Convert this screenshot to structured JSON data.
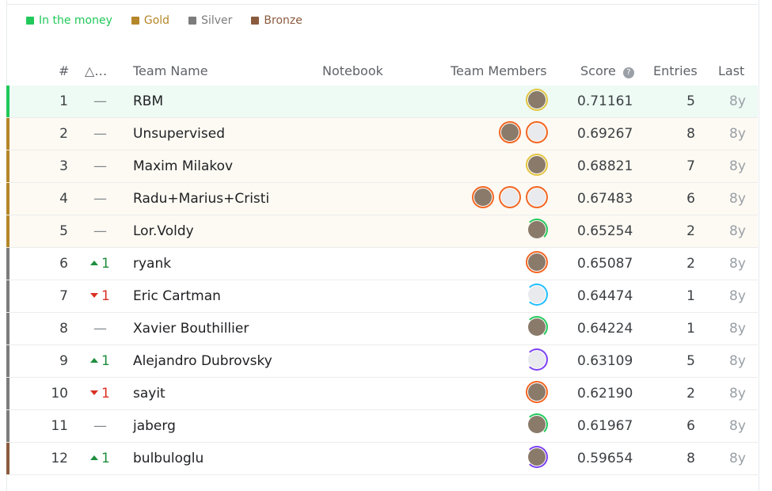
{
  "legend": [
    {
      "label": "In the money",
      "color": "#20c95a"
    },
    {
      "label": "Gold",
      "color": "#b5872a"
    },
    {
      "label": "Silver",
      "color": "#7c7c7c"
    },
    {
      "label": "Bronze",
      "color": "#8b5b3e"
    }
  ],
  "header": {
    "rank": "#",
    "delta": "△…",
    "team": "Team Name",
    "notebook": "Notebook",
    "members": "Team Members",
    "score": "Score",
    "entries": "Entries",
    "last": "Last"
  },
  "rows": [
    {
      "rank": "1",
      "delta": "—",
      "dir": "none",
      "team": "RBM",
      "score": "0.71161",
      "entries": "5",
      "last": "8y",
      "tier": "money",
      "members": [
        {
          "ring": "gold",
          "icon": "person-avatar-icon"
        }
      ]
    },
    {
      "rank": "2",
      "delta": "—",
      "dir": "none",
      "team": "Unsupervised",
      "score": "0.69267",
      "entries": "8",
      "last": "8y",
      "tier": "gold",
      "members": [
        {
          "ring": "orange",
          "icon": "person-avatar-icon"
        },
        {
          "ring": "orange",
          "icon": "default-avatar-icon"
        }
      ]
    },
    {
      "rank": "3",
      "delta": "—",
      "dir": "none",
      "team": "Maxim Milakov",
      "score": "0.68821",
      "entries": "7",
      "last": "8y",
      "tier": "gold",
      "members": [
        {
          "ring": "gold",
          "icon": "person-avatar-icon"
        }
      ]
    },
    {
      "rank": "4",
      "delta": "—",
      "dir": "none",
      "team": "Radu+Marius+Cristi",
      "score": "0.67483",
      "entries": "6",
      "last": "8y",
      "tier": "gold",
      "members": [
        {
          "ring": "orange",
          "icon": "person-avatar-icon"
        },
        {
          "ring": "orange",
          "icon": "default-avatar-icon"
        },
        {
          "ring": "orange",
          "icon": "default-avatar-icon"
        }
      ]
    },
    {
      "rank": "5",
      "delta": "—",
      "dir": "none",
      "team": "Lor.Voldy",
      "score": "0.65254",
      "entries": "2",
      "last": "8y",
      "tier": "gold",
      "members": [
        {
          "ring": "green",
          "icon": "person-avatar-icon"
        }
      ]
    },
    {
      "rank": "6",
      "delta": "1",
      "dir": "up",
      "team": "ryank",
      "score": "0.65087",
      "entries": "2",
      "last": "8y",
      "tier": "silver",
      "members": [
        {
          "ring": "orange",
          "icon": "person-avatar-icon"
        }
      ]
    },
    {
      "rank": "7",
      "delta": "1",
      "dir": "down",
      "team": "Eric Cartman",
      "score": "0.64474",
      "entries": "1",
      "last": "8y",
      "tier": "silver",
      "members": [
        {
          "ring": "blue",
          "icon": "default-avatar-icon"
        }
      ]
    },
    {
      "rank": "8",
      "delta": "—",
      "dir": "none",
      "team": "Xavier Bouthillier",
      "score": "0.64224",
      "entries": "1",
      "last": "8y",
      "tier": "silver",
      "members": [
        {
          "ring": "green",
          "icon": "person-avatar-icon"
        }
      ]
    },
    {
      "rank": "9",
      "delta": "1",
      "dir": "up",
      "team": "Alejandro Dubrovsky",
      "score": "0.63109",
      "entries": "5",
      "last": "8y",
      "tier": "silver",
      "members": [
        {
          "ring": "purple",
          "icon": "default-avatar-icon"
        }
      ]
    },
    {
      "rank": "10",
      "delta": "1",
      "dir": "down",
      "team": "sayit",
      "score": "0.62190",
      "entries": "2",
      "last": "8y",
      "tier": "silver",
      "members": [
        {
          "ring": "orange",
          "icon": "person-avatar-icon"
        }
      ]
    },
    {
      "rank": "11",
      "delta": "—",
      "dir": "none",
      "team": "jaberg",
      "score": "0.61967",
      "entries": "6",
      "last": "8y",
      "tier": "silver",
      "members": [
        {
          "ring": "green",
          "icon": "person-avatar-icon"
        }
      ]
    },
    {
      "rank": "12",
      "delta": "1",
      "dir": "up",
      "team": "bulbuloglu",
      "score": "0.59654",
      "entries": "8",
      "last": "8y",
      "tier": "bronze",
      "members": [
        {
          "ring": "purple",
          "icon": "person-avatar-icon"
        }
      ]
    }
  ]
}
